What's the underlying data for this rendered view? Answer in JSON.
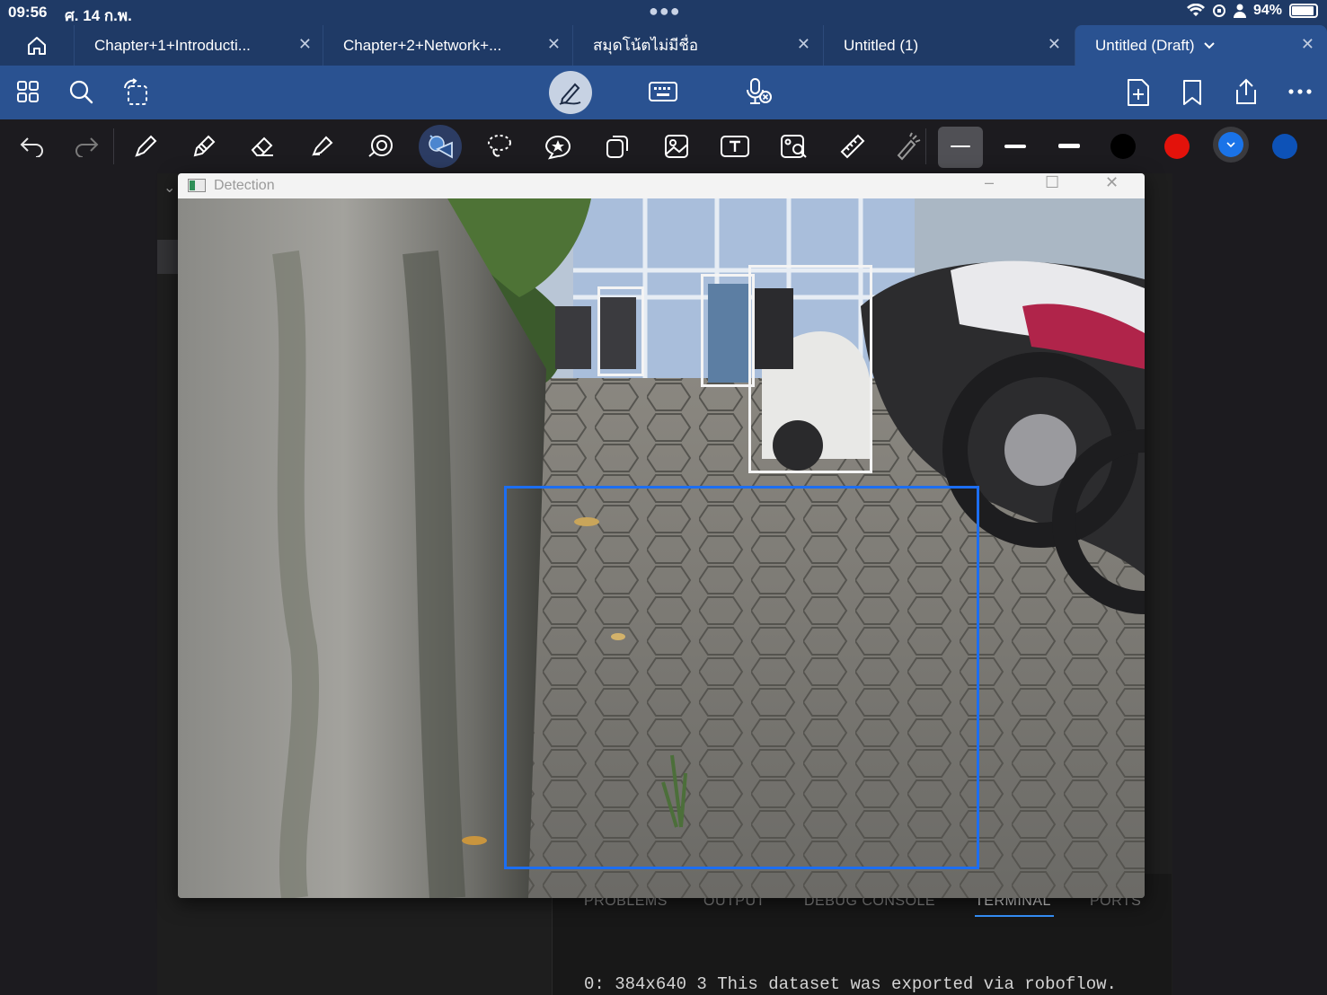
{
  "status_bar": {
    "time": "09:56",
    "date": "ศ. 14 ก.พ.",
    "battery": "94%"
  },
  "tabs": [
    {
      "label": "Chapter+1+Introducti...",
      "active": false
    },
    {
      "label": "Chapter+2+Network+...",
      "active": false
    },
    {
      "label": "สมุดโน้ตไม่มีชื่อ",
      "active": false
    },
    {
      "label": "Untitled (1)",
      "active": false
    },
    {
      "label": "Untitled (Draft)",
      "active": true
    }
  ],
  "toolbar_icons": [
    "grid-icon",
    "search-icon",
    "lasso-rotate-icon",
    "pen-mode-icon",
    "keyboard-icon",
    "mic-icon",
    "add-page-icon",
    "bookmark-icon",
    "share-icon",
    "more-icon"
  ],
  "tools": [
    "undo-icon",
    "redo-icon",
    "pen-icon",
    "pencil-icon",
    "eraser-icon",
    "highlighter-icon",
    "spiral-icon",
    "shapes-icon",
    "lasso-icon",
    "sticker-icon",
    "copy-icon",
    "image-icon",
    "text-icon",
    "image-search-icon",
    "ruler-icon",
    "laser-icon"
  ],
  "colors": {
    "swatch_black": "#000000",
    "swatch_red": "#e3120b",
    "swatch_blue_selected": "#1a73e8",
    "swatch_dark_blue": "#0d52b7",
    "accent": "#2a5291"
  },
  "detection_window": {
    "title": "Detection",
    "minimize": "–",
    "maximize": "☐",
    "close": "✕"
  },
  "terminal": {
    "tabs": [
      "PROBLEMS",
      "OUTPUT",
      "DEBUG CONSOLE",
      "TERMINAL",
      "PORTS"
    ],
    "active_tab": "TERMINAL",
    "line": "0: 384x640 3 This dataset was exported via roboflow."
  }
}
